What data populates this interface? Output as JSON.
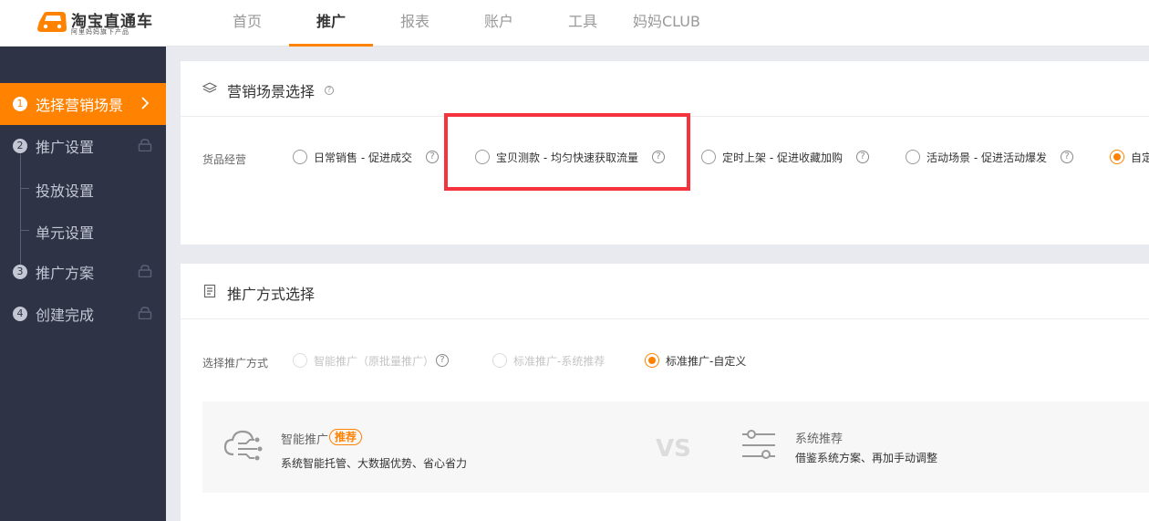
{
  "app": {
    "logo_title": "淘宝直通车",
    "logo_subtitle": "阿里妈妈旗下产品",
    "brand_color": "#ff8200"
  },
  "nav": [
    {
      "label": "首页"
    },
    {
      "label": "推广",
      "active": true
    },
    {
      "label": "报表"
    },
    {
      "label": "账户"
    },
    {
      "label": "工具"
    },
    {
      "label": "妈妈CLUB"
    }
  ],
  "sidebar": {
    "steps": [
      {
        "num": "1",
        "label": "选择营销场景",
        "active": true
      },
      {
        "num": "2",
        "label": "推广设置",
        "locked": true
      },
      {
        "num": "",
        "label": "投放设置"
      },
      {
        "num": "",
        "label": "单元设置"
      },
      {
        "num": "3",
        "label": "推广方案",
        "locked": true
      },
      {
        "num": "4",
        "label": "创建完成",
        "locked": true
      }
    ]
  },
  "scene_section": {
    "title": "营销场景选择",
    "row_label": "货品经营",
    "options": [
      {
        "label": "日常销售 - 促进成交"
      },
      {
        "label": "宝贝测款 - 均匀快速获取流量"
      },
      {
        "label": "定时上架 - 促进收藏加购"
      },
      {
        "label": "活动场景 - 促进活动爆发"
      },
      {
        "label": "自定义场景",
        "selected": true
      }
    ]
  },
  "method_section": {
    "title": "推广方式选择",
    "row_label": "选择推广方式",
    "options": [
      {
        "label": "智能推广（原批量推广）",
        "disabled": true
      },
      {
        "label": "标准推广-系统推荐",
        "disabled": true
      },
      {
        "label": "标准推广-自定义",
        "selected": true
      }
    ],
    "compare": {
      "left_title": "智能推广",
      "left_badge": "推荐",
      "left_desc": "系统智能托管、大数据优势、省心省力",
      "vs": "VS",
      "right_title": "系统推荐",
      "right_desc": "借鉴系统方案、再加手动调整"
    }
  },
  "help_glyph": "?"
}
